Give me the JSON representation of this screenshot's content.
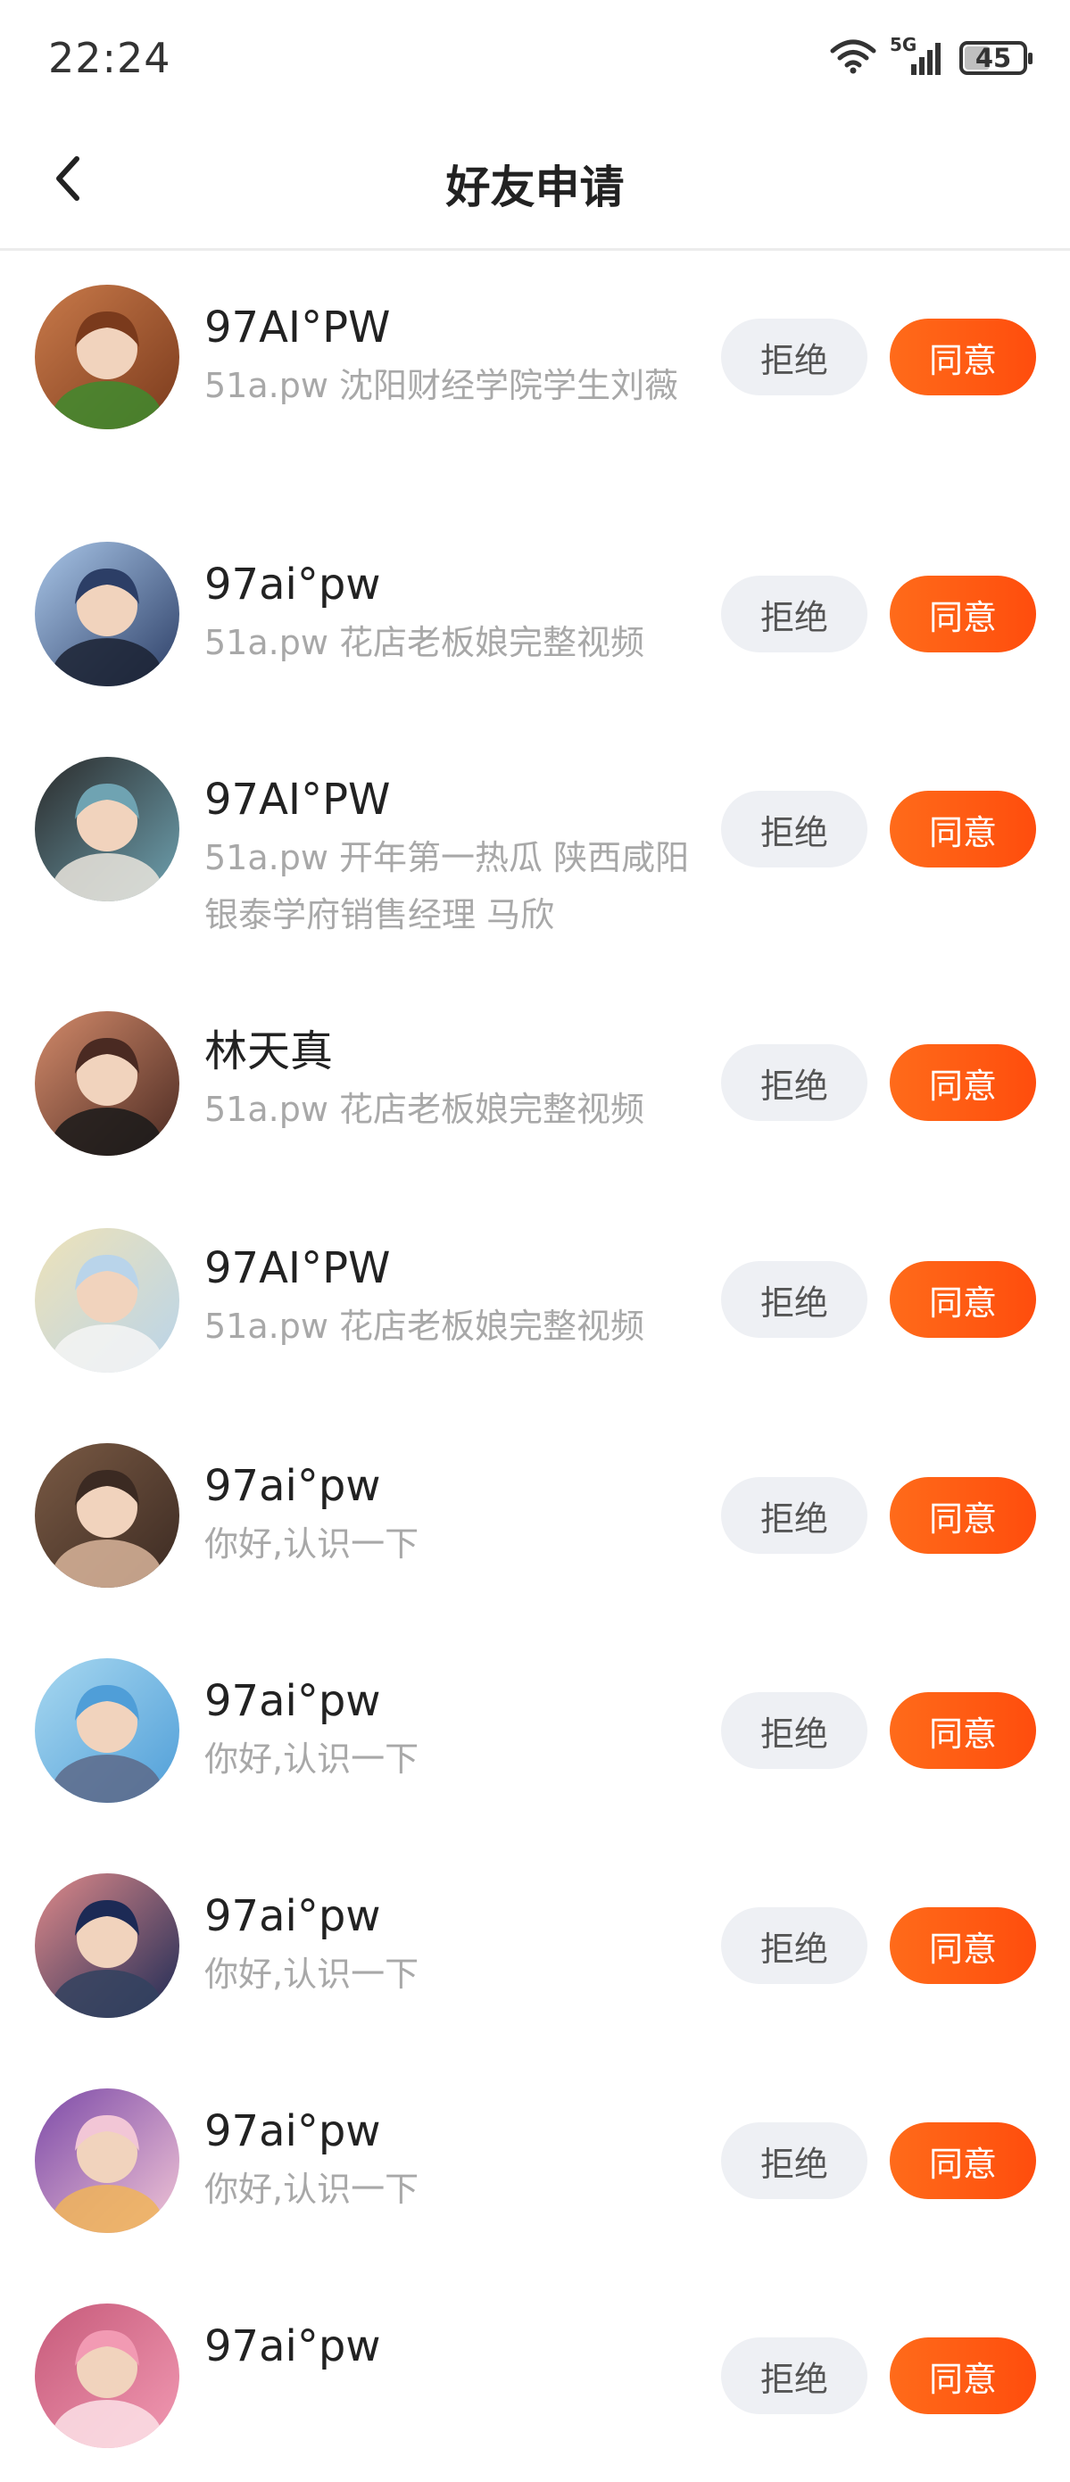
{
  "status_bar": {
    "time": "22:24",
    "network": "5G",
    "battery": "45",
    "battery_level_percent": 45
  },
  "nav": {
    "title": "好友申请",
    "back_icon": "chevron-left-icon"
  },
  "buttons": {
    "reject_label": "拒绝",
    "accept_label": "同意"
  },
  "requests": [
    {
      "name": "97AI°PW",
      "message": "51a.pw 沈阳财经学院学生刘薇",
      "avatar_colors": [
        "#7a3a1c",
        "#c97a4a",
        "#3f8a2e"
      ]
    },
    {
      "name": "97ai°pw",
      "message": "51a.pw 花店老板娘完整视频",
      "avatar_colors": [
        "#2c3e66",
        "#a9c6e8",
        "#1b2233"
      ]
    },
    {
      "name": "97AI°PW",
      "message": "51a.pw 开年第一热瓜 陕西咸阳银泰学府销售经理 马欣",
      "avatar_colors": [
        "#6fa3b2",
        "#2a2a2a",
        "#e9e4dc"
      ]
    },
    {
      "name": "林天真",
      "message": "51a.pw 花店老板娘完整视频",
      "avatar_colors": [
        "#4a2a22",
        "#d38a6a",
        "#1a1a1a"
      ]
    },
    {
      "name": "97AI°PW",
      "message": "51a.pw 花店老板娘完整视频",
      "avatar_colors": [
        "#b9d4ea",
        "#eee2b8",
        "#f4f4f4"
      ]
    },
    {
      "name": "97ai°pw",
      "message": "你好,认识一下",
      "avatar_colors": [
        "#3b2a22",
        "#7a5a44",
        "#d8b49a"
      ]
    },
    {
      "name": "97ai°pw",
      "message": "你好,认识一下",
      "avatar_colors": [
        "#4f9ed8",
        "#a8d8f0",
        "#5d6a8a"
      ]
    },
    {
      "name": "97ai°pw",
      "message": "你好,认识一下",
      "avatar_colors": [
        "#1c2a55",
        "#e08a8a",
        "#33425f"
      ]
    },
    {
      "name": "97ai°pw",
      "message": "你好,认识一下",
      "avatar_colors": [
        "#f2c6d6",
        "#7c4aa8",
        "#f0b45a"
      ]
    },
    {
      "name": "97ai°pw",
      "message": "",
      "avatar_colors": [
        "#f29ab3",
        "#c65a7a",
        "#fbe0e6"
      ]
    }
  ]
}
